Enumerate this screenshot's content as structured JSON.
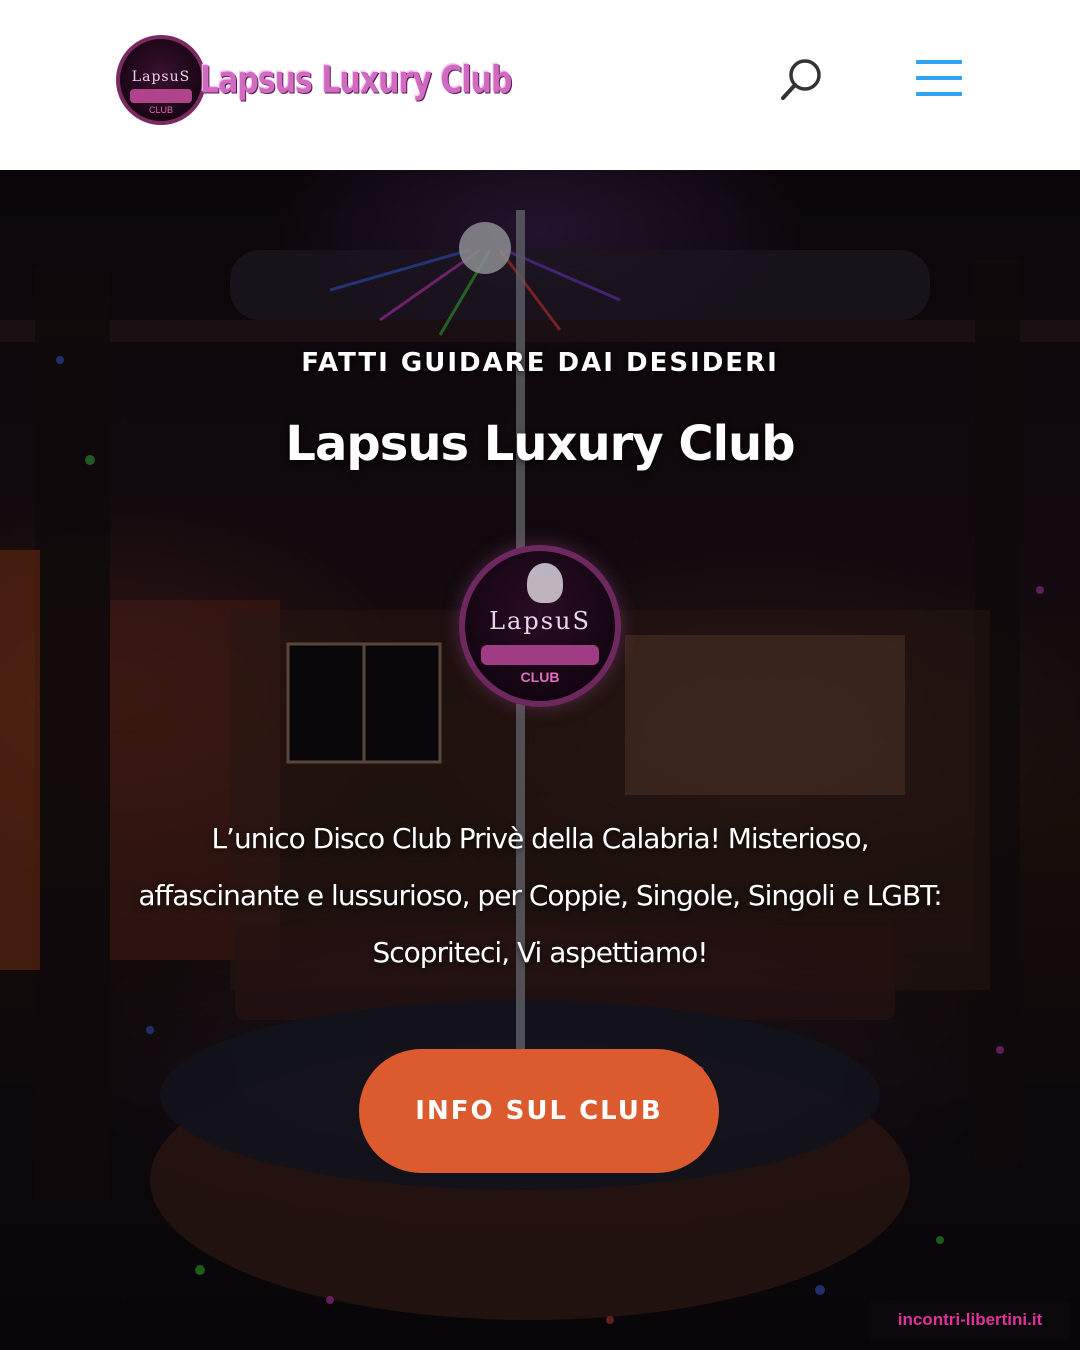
{
  "header": {
    "logo": {
      "badge_text": "LapsuS",
      "badge_subtext": "CLUB",
      "wordmark": "Lapsus Luxury Club",
      "colors": {
        "wordmark": "#d16bc2",
        "badge_ring": "#7a2a62"
      }
    },
    "icons": {
      "search": "search-icon",
      "menu": "hamburger-menu-icon"
    },
    "colors": {
      "background": "#ffffff",
      "menu_icon": "#2ea3f2",
      "search_icon": "#333333"
    }
  },
  "hero": {
    "eyebrow": "FATTI GUIDARE DAI DESIDERI",
    "title": "Lapsus Luxury Club",
    "badge": {
      "top": "LapsuS",
      "bottom": "CLUB"
    },
    "description_lines": [
      "L’unico Disco Club Privè della Calabria! Misterioso,",
      "affascinante e lussurioso, per Coppie, Singole, Singoli e LGBT:",
      "Scopriteci, Vi aspettiamo!"
    ],
    "cta_label": "INFO SUL CLUB",
    "colors": {
      "cta": "#db5a2e",
      "text": "#ffffff"
    }
  },
  "watermark": {
    "text": "incontri-libertini.it",
    "color": "#e0309a"
  }
}
